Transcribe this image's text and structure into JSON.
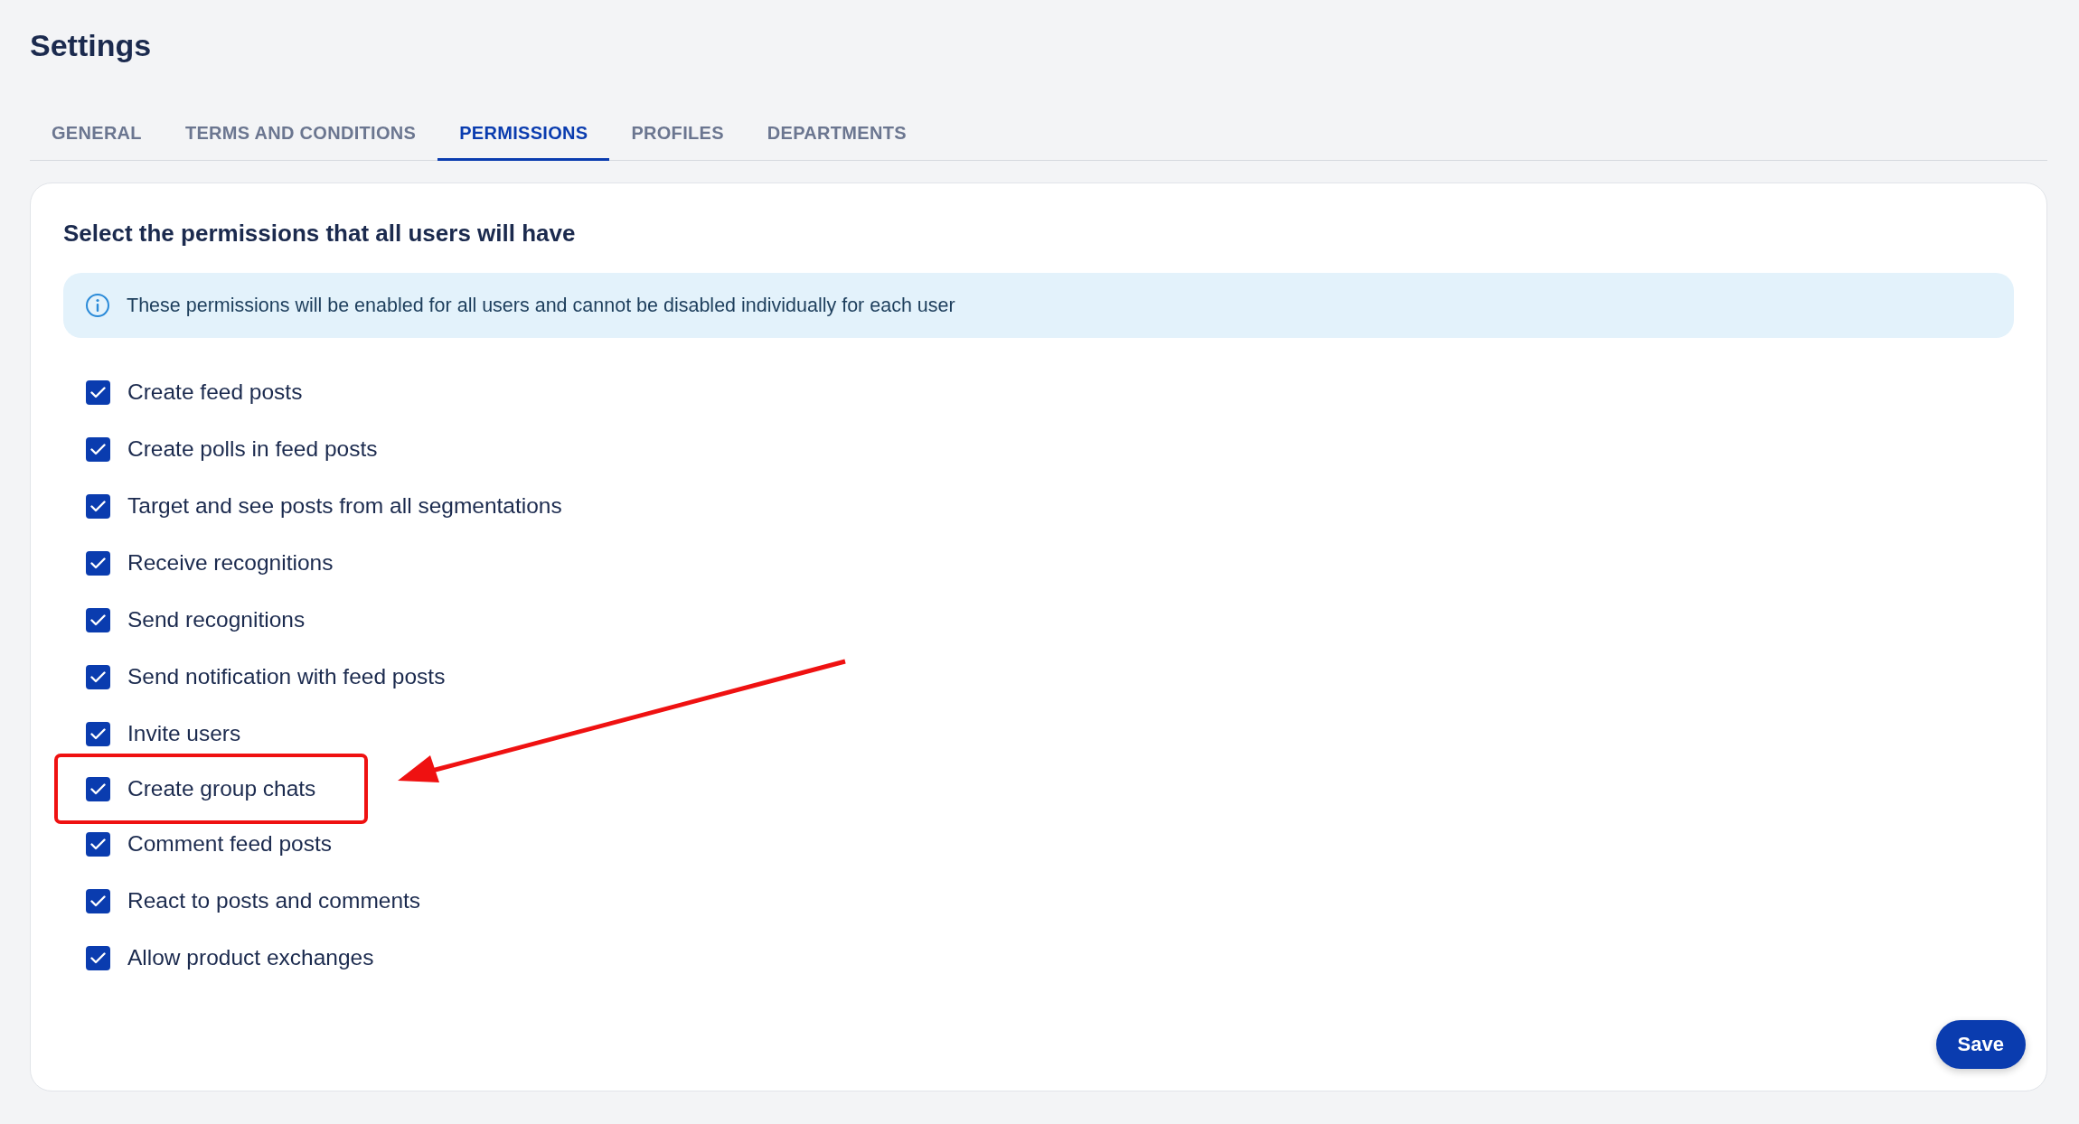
{
  "page": {
    "title": "Settings"
  },
  "tabs": [
    {
      "label": "GENERAL",
      "selected": false
    },
    {
      "label": "TERMS AND CONDITIONS",
      "selected": false
    },
    {
      "label": "PERMISSIONS",
      "selected": true
    },
    {
      "label": "PROFILES",
      "selected": false
    },
    {
      "label": "DEPARTMENTS",
      "selected": false
    }
  ],
  "card": {
    "heading": "Select the permissions that all users will have",
    "info": "These permissions will be enabled for all users and cannot be disabled individually for each user"
  },
  "permissions": [
    {
      "label": "Create feed posts",
      "checked": true,
      "highlighted": false
    },
    {
      "label": "Create polls in feed posts",
      "checked": true,
      "highlighted": false
    },
    {
      "label": "Target and see posts from all segmentations",
      "checked": true,
      "highlighted": false
    },
    {
      "label": "Receive recognitions",
      "checked": true,
      "highlighted": false
    },
    {
      "label": "Send recognitions",
      "checked": true,
      "highlighted": false
    },
    {
      "label": "Send notification with feed posts",
      "checked": true,
      "highlighted": false
    },
    {
      "label": "Invite users",
      "checked": true,
      "highlighted": false
    },
    {
      "label": "Create group chats",
      "checked": true,
      "highlighted": true
    },
    {
      "label": "Comment feed posts",
      "checked": true,
      "highlighted": false
    },
    {
      "label": "React to posts and comments",
      "checked": true,
      "highlighted": false
    },
    {
      "label": "Allow product exchanges",
      "checked": true,
      "highlighted": false
    }
  ],
  "buttons": {
    "save": "Save"
  }
}
